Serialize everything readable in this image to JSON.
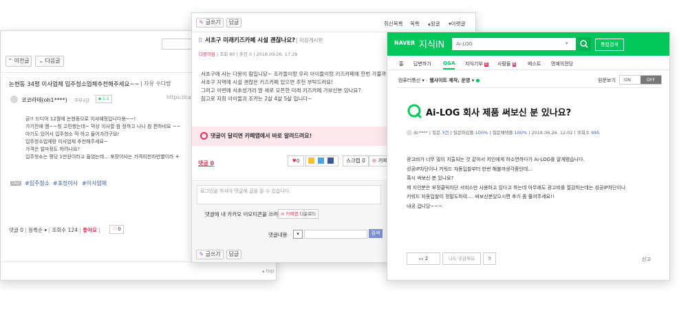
{
  "left": {
    "prev_label": "이전글",
    "next_label": "다음글",
    "title": "논현동 34평 이사업체 입주청소업체추천해주세요~~",
    "board": "자유 수다방",
    "url": "https://cafe",
    "author": "코코라테(oh1****)",
    "badge": "주부1단",
    "chat_count": "1:1",
    "body": [
      "곧!! 드디어 12월에 논현동으로 이사예정입니다용~~!",
      "가기전에 옘~~청 고민했는데~ 막상 이사할 참 정하고 나니 참 편하네요 ~~",
      "아기도 있어서 입주청소 딱 하고 들어가려구요!",
      "입주청소업체랑 이사업체 추천해주세요~",
      "가격은 얼마정도 하려나요?",
      "입주청소는 평당 1만원이라고 들었는데... 포장이사는 가격이천차만별이라 ☀"
    ],
    "tag_icon": "TAG",
    "tags": [
      "#입주청소",
      "#포장이사",
      "#이사업체"
    ],
    "comment_label": "댓글",
    "comment_count": "0",
    "register_order": "등록순",
    "views_label": "조회수",
    "views": "124",
    "like_label": "좋아요",
    "like_count": "0",
    "top_label": "top"
  },
  "middle": {
    "write_label": "글쓰기",
    "reply_label": "답글",
    "member_cafe": "회신목록",
    "list_label": "목록",
    "prev_label": "▴윗글",
    "next_label": "▾아랫글",
    "title": "서초구 미래키즈카페 시설 괜찮나요?",
    "board": "자유게시판",
    "author": "다몽이맘",
    "views": "조회 80",
    "likes": "추천 0",
    "date": "2018.09.26. 17:29",
    "body": [
      "서초구에 사는 다몽이 맘입니당~ 조카들이랑 우리 아이들이랑 키즈카페에 한번 가볼까 ~",
      "서초구 지역에 시설 괜찮은 키즈카페 있으면 추천 부탁드려요!",
      "그리고 이번에 서초성거리 말 새로 오픈한 미래 키즈카페 가보신분 있나요?",
      "참고로 저희 아이들과 조카는 2살 4살 5살 입니다~"
    ],
    "alert_text": "댓글이 달리면 카페앱에서 바로 알려드려요!",
    "comment_label": "댓글 0",
    "like_count": "0",
    "scrap_label": "스크랩 0",
    "cafe_label": "카페",
    "comment_placeholder": "로그인을 하셔야 댓글에 글을 쓸 수 있습니다.",
    "kakao_text": "댓글에 내 카카오 이모티콘을 쓰려면?",
    "cafe_app_label": "카페앱",
    "download_label": "다운로드",
    "search_scope": "댓글내용",
    "search_button": "검색",
    "bottom_write": "글쓰기",
    "bottom_reply": "답글"
  },
  "right": {
    "naver": "NAVER",
    "jisikin": "지식iN",
    "search_value": "Ai-LOG",
    "search_button": "통합검색",
    "nav": [
      "홈",
      "답변하기",
      "Q&A",
      "지식기부",
      "사람들",
      "베스트",
      "명예의전당"
    ],
    "nav_new_badge": "N",
    "breadcrumb_1": "컴퓨터통신",
    "breadcrumb_2": "웹사이트 제작, 운영",
    "original_view": "원문보기",
    "toggle_on": "ON",
    "toggle_off": "OFF",
    "question_title": "Ai-LOG 회사 제품 써보신 분 있나요?",
    "asker": "dc****",
    "q_count_label": "질문",
    "q_count": "3건",
    "q_close_label": "질문마감률",
    "q_close": "100%",
    "q_choice_label": "질문채택률",
    "q_choice": "100%",
    "date": "2018.06.26. 12:02",
    "views_label": "조회수",
    "views": "995",
    "body": [
      "광고비가 너무 많이 지출되는 것 같아서 지인에게 하소연하다가 Ai-LOG를 알게됐습니다.",
      "성공IP차단이나 키워드 자동입찰부터 한번 해볼까생각중인데...",
      "혹시 써보신 분 있나요?",
      "제 지인분은 부정클릭차단 서비스만 사용하고 있다고 하는데 아무래도 광고비를 절감하는데는 성공IP차단이나",
      "키워드 자동입찰이 정말도하여.... 써보신분있으시면 후기 좀 풀어주세요!!",
      "내공 겁니당~~~"
    ],
    "answer_count": "2",
    "curious_label": "나도 궁금해요",
    "report_label": "신고"
  },
  "colors": {
    "naver_green": "#03c75a",
    "pink": "#e0325a",
    "link_blue": "#3b5fa3"
  }
}
